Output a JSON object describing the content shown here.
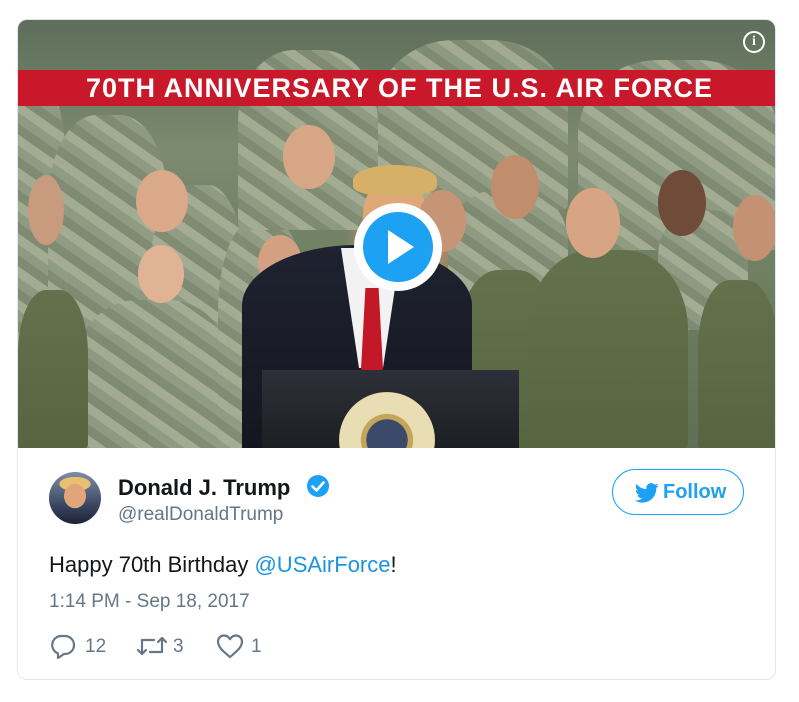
{
  "video": {
    "banner_text": "70TH ANNIVERSARY OF THE U.S. AIR FORCE",
    "info_icon": "info-icon",
    "play_icon": "play-icon"
  },
  "author": {
    "name": "Donald J. Trump",
    "handle": "@realDonaldTrump",
    "verified": true
  },
  "follow_button": {
    "label": "Follow",
    "icon": "twitter-bird-icon"
  },
  "tweet": {
    "text_before": "Happy 70th Birthday ",
    "mention": "@USAirForce",
    "text_after": "!",
    "timestamp": "1:14 PM - Sep 18, 2017"
  },
  "actions": {
    "replies": "12",
    "retweets": "3",
    "likes": "1"
  },
  "colors": {
    "accent": "#1da1f2",
    "banner": "#c8182a",
    "link": "#1b95e0",
    "muted": "#657786"
  }
}
